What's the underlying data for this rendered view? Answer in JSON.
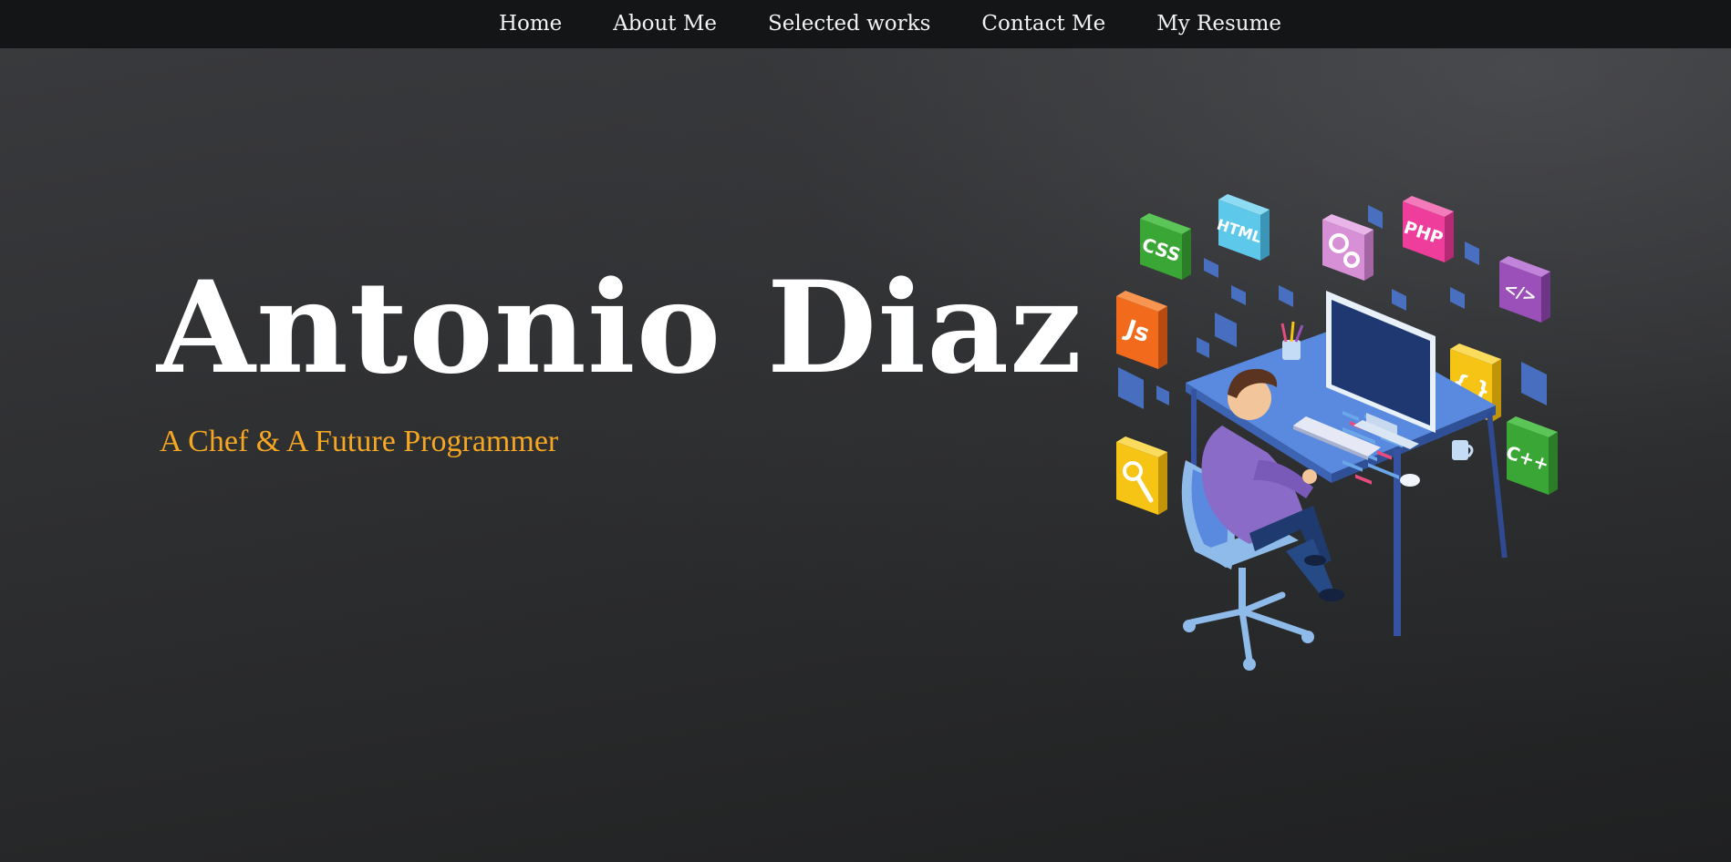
{
  "nav": {
    "items": [
      {
        "label": "Home"
      },
      {
        "label": "About Me"
      },
      {
        "label": "Selected works"
      },
      {
        "label": "Contact Me"
      },
      {
        "label": "My Resume"
      }
    ]
  },
  "hero": {
    "name": "Antonio Diaz",
    "tagline": "A Chef & A Future Programmer"
  },
  "illustration": {
    "badges": {
      "css": "CSS",
      "html": "HTML",
      "php": "PHP",
      "js": "Js",
      "code": "</>",
      "braces": "{ }",
      "cpp": "C++"
    }
  },
  "colors": {
    "accent": "#f5a623",
    "navbar_bg": "#141516",
    "hero_bg": "#2a2b2d"
  }
}
